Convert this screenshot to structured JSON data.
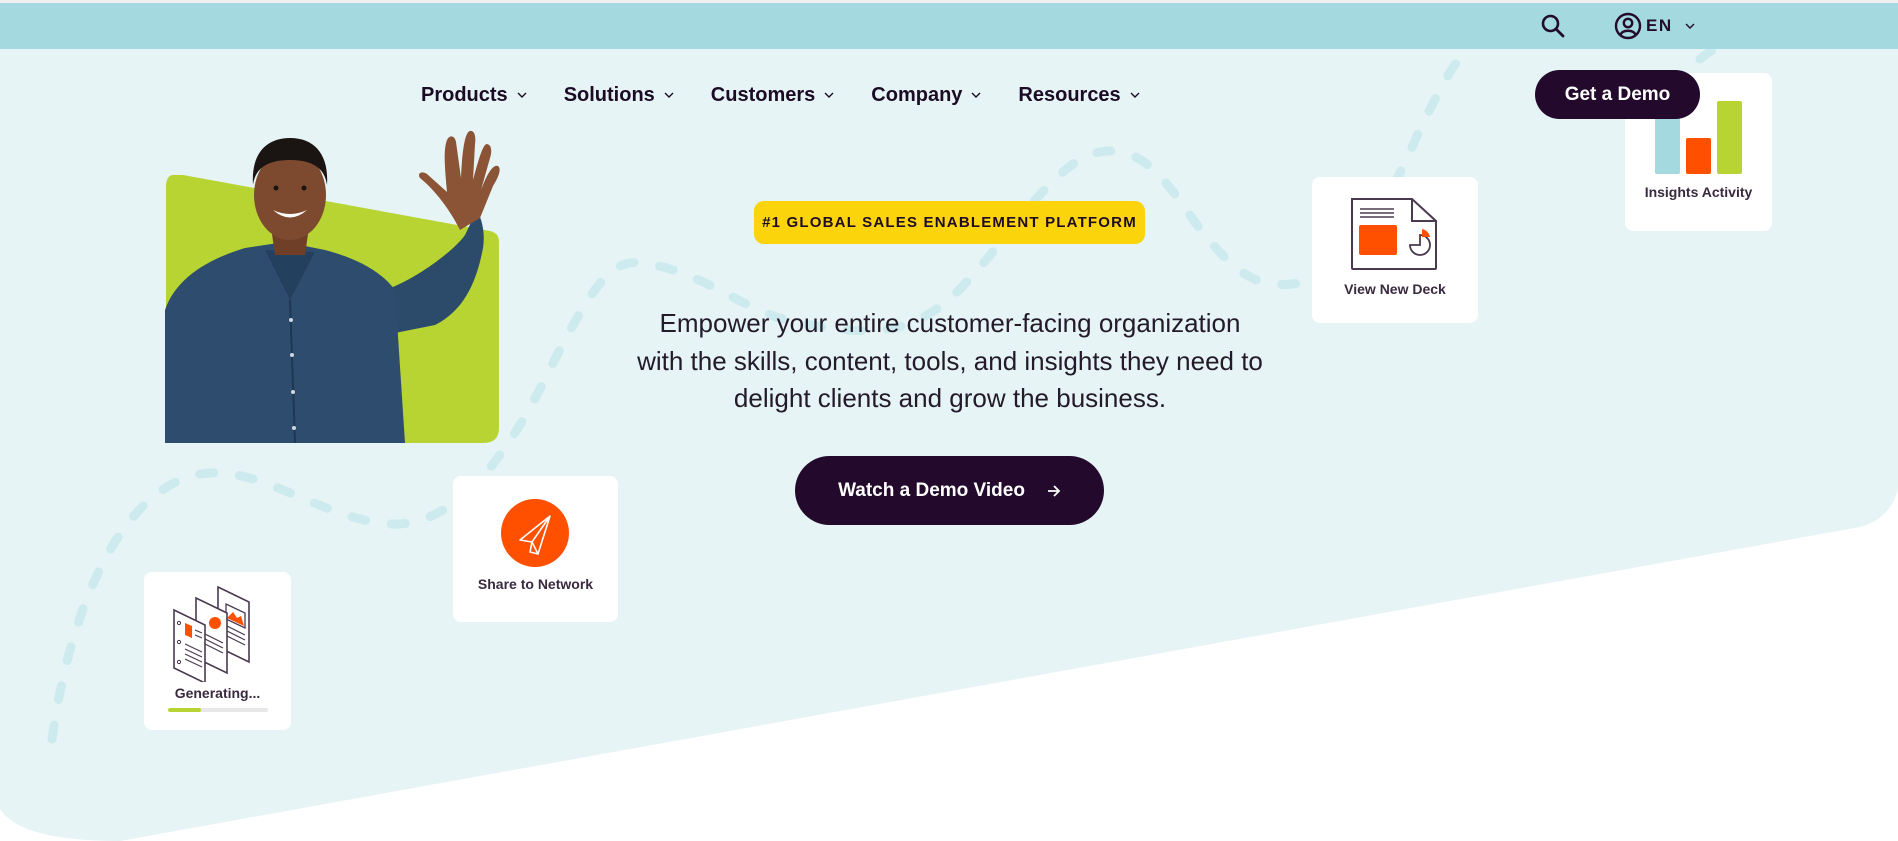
{
  "utility_bar": {
    "search_icon": "search-icon",
    "account_icon": "user-circle-icon",
    "language": "EN",
    "language_chevron": "chevron-down-icon"
  },
  "nav": {
    "items": [
      {
        "label": "Products",
        "icon": "chevron-down-icon"
      },
      {
        "label": "Solutions",
        "icon": "chevron-down-icon"
      },
      {
        "label": "Customers",
        "icon": "chevron-down-icon"
      },
      {
        "label": "Company",
        "icon": "chevron-down-icon"
      },
      {
        "label": "Resources",
        "icon": "chevron-down-icon"
      }
    ],
    "cta_label": "Get a Demo"
  },
  "hero": {
    "badge": "#1 GLOBAL SALES ENABLEMENT PLATFORM",
    "headline_lines": [
      "Empower your entire customer-facing organization",
      "with the skills, content, tools, and insights they need to",
      "delight clients and grow the business."
    ],
    "cta_label": "Watch a Demo Video",
    "cta_icon": "arrow-right-icon",
    "photo_alt": "smiling man waving"
  },
  "floating_cards": {
    "insights": {
      "label": "Insights Activity",
      "icon": "bar-chart-icon"
    },
    "deck": {
      "label": "View New Deck",
      "icon": "presentation-document-icon"
    },
    "share": {
      "label": "Share to Network",
      "icon": "paper-plane-icon"
    },
    "generating": {
      "label": "Generating...",
      "icon": "documents-stack-icon",
      "progress_percent": 33
    }
  },
  "colors": {
    "utility_bar": "#a3d9df",
    "hero_background": "#e6f4f5",
    "primary_dark": "#230a2c",
    "badge_yellow": "#fbd40b",
    "accent_orange": "#ff5000",
    "accent_green": "#b8d432",
    "accent_teal": "#a3d9df"
  }
}
